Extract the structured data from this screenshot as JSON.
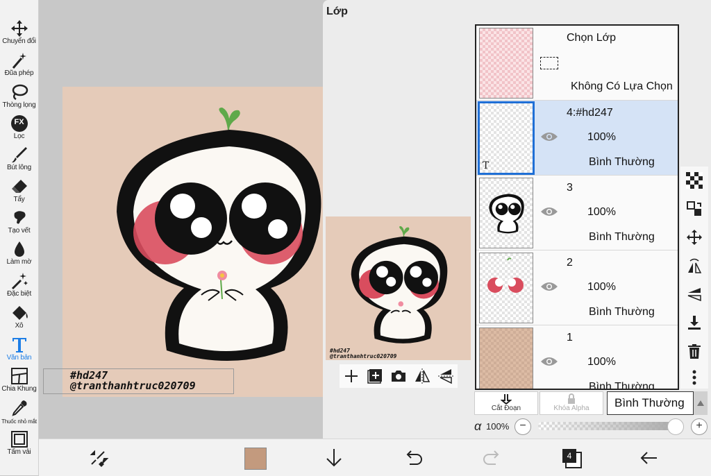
{
  "toolbar": {
    "tools": [
      {
        "label": "Chuyển đổi",
        "icon": "move-icon"
      },
      {
        "label": "Đũa phép",
        "icon": "magic-wand-icon"
      },
      {
        "label": "Thòng lọng",
        "icon": "lasso-icon"
      },
      {
        "label": "Lọc",
        "icon": "fx-filter-icon",
        "badge": "FX"
      },
      {
        "label": "Bút lông",
        "icon": "brush-icon"
      },
      {
        "label": "Tẩy",
        "icon": "eraser-icon"
      },
      {
        "label": "Tạo vết",
        "icon": "smudge-icon"
      },
      {
        "label": "Làm mờ",
        "icon": "blur-icon"
      },
      {
        "label": "Đặc biệt",
        "icon": "special-sparkle-icon"
      },
      {
        "label": "Xô",
        "icon": "bucket-icon"
      },
      {
        "label": "Văn bản",
        "icon": "text-tool-icon",
        "active": true
      },
      {
        "label": "Chia Khung",
        "icon": "frame-divider-icon"
      },
      {
        "label": "Thuốc nhỏ mắt",
        "icon": "eyedropper-icon"
      },
      {
        "label": "Tấm vải",
        "icon": "canvas-icon"
      }
    ]
  },
  "canvas": {
    "watermark_line1": "#hd247",
    "watermark_line2": "@tranthanhtruc020709",
    "artboard_color": "#e5cbb9"
  },
  "layer_panel": {
    "title": "Lớp",
    "selection_layer": {
      "title": "Chọn Lớp",
      "status": "Không Có Lựa Chọn"
    },
    "layers": [
      {
        "name": "4:#hd247",
        "opacity": "100%",
        "blend": "Bình Thường",
        "selected": true
      },
      {
        "name": "3",
        "opacity": "100%",
        "blend": "Bình Thường",
        "selected": false
      },
      {
        "name": "2",
        "opacity": "100%",
        "blend": "Bình Thường",
        "selected": false
      },
      {
        "name": "1",
        "opacity": "100%",
        "blend": "Bình Thường",
        "selected": false
      }
    ],
    "clip_label": "Cắt Đoạn",
    "alpha_lock_label": "Khóa Alpha",
    "blend_mode": "Bình Thường",
    "alpha_symbol": "α",
    "alpha_value": "100%",
    "alpha_fraction": 1.0
  },
  "bottom_bar": {
    "layer_count": "4",
    "color_swatch": "#c39a7e"
  },
  "colors": {
    "accent": "#1e7ee6",
    "selected_layer_bg": "#d5e3f6",
    "blush": "#d94d5e"
  }
}
